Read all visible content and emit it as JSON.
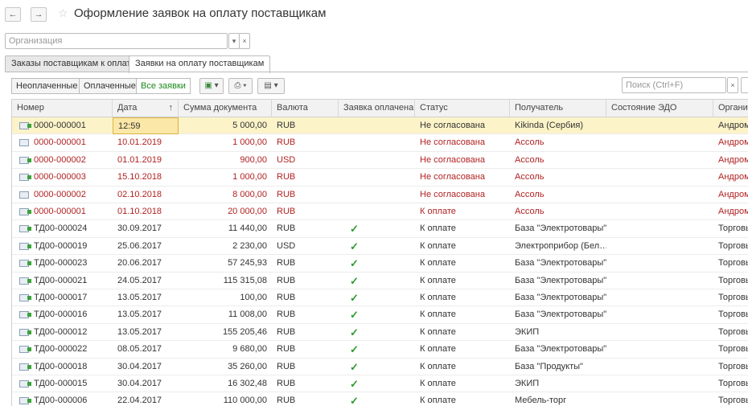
{
  "window": {
    "title": "Оформление заявок на оплату поставщикам",
    "back_icon": "arrow-left-icon",
    "forward_icon": "arrow-right-icon",
    "favorite_icon": "star-icon"
  },
  "filter": {
    "organization_placeholder": "Организация",
    "dropdown_glyph": "▾",
    "clear_glyph": "×"
  },
  "tabs": [
    {
      "label": "Заказы поставщикам к оплате"
    },
    {
      "label": "Заявки на оплату поставщикам"
    }
  ],
  "toolbar": {
    "unpaid": "Неоплаченные",
    "paid": "Оплаченные",
    "all": "Все заявки",
    "search_placeholder": "Поиск (Ctrl+F)",
    "search_clear": "×"
  },
  "table": {
    "columns": [
      "Номер",
      "Дата",
      "Сумма документа",
      "Валюта",
      "Заявка оплачена",
      "Статус",
      "Получатель",
      "Состояние ЭДО",
      "Организ"
    ],
    "sort_indicator": "↑",
    "rows": [
      {
        "num": "0000-000001",
        "date": "12:59",
        "sum": "5 000,00",
        "cur": "RUB",
        "paid": "",
        "status": "Не согласована",
        "recipient": "Kikinda (Сербия)",
        "edo": "",
        "org": "Андром",
        "style": "selected",
        "icon": "posted"
      },
      {
        "num": "0000-000001",
        "date": "10.01.2019",
        "sum": "1 000,00",
        "cur": "RUB",
        "paid": "",
        "status": "Не согласована",
        "recipient": "Ассоль",
        "edo": "",
        "org": "Андром",
        "style": "red",
        "icon": "plain"
      },
      {
        "num": "0000-000002",
        "date": "01.01.2019",
        "sum": "900,00",
        "cur": "USD",
        "paid": "",
        "status": "Не согласована",
        "recipient": "Ассоль",
        "edo": "",
        "org": "Андром",
        "style": "red",
        "icon": "posted"
      },
      {
        "num": "0000-000003",
        "date": "15.10.2018",
        "sum": "1 000,00",
        "cur": "RUB",
        "paid": "",
        "status": "Не согласована",
        "recipient": "Ассоль",
        "edo": "",
        "org": "Андром",
        "style": "red",
        "icon": "posted"
      },
      {
        "num": "0000-000002",
        "date": "02.10.2018",
        "sum": "8 000,00",
        "cur": "RUB",
        "paid": "",
        "status": "Не согласована",
        "recipient": "Ассоль",
        "edo": "",
        "org": "Андром",
        "style": "red",
        "icon": "plain"
      },
      {
        "num": "0000-000001",
        "date": "01.10.2018",
        "sum": "20 000,00",
        "cur": "RUB",
        "paid": "",
        "status": "К оплате",
        "recipient": "Ассоль",
        "edo": "",
        "org": "Андром",
        "style": "red",
        "icon": "posted"
      },
      {
        "num": "ТД00-000024",
        "date": "30.09.2017",
        "sum": "11 440,00",
        "cur": "RUB",
        "paid": "✓",
        "status": "К оплате",
        "recipient": "База \"Электротовары\"",
        "edo": "",
        "org": "Торговь",
        "style": "normal",
        "icon": "posted"
      },
      {
        "num": "ТД00-000019",
        "date": "25.06.2017",
        "sum": "2 230,00",
        "cur": "USD",
        "paid": "✓",
        "status": "К оплате",
        "recipient": "Электроприбор (Бел…",
        "edo": "",
        "org": "Торговь",
        "style": "normal",
        "icon": "posted"
      },
      {
        "num": "ТД00-000023",
        "date": "20.06.2017",
        "sum": "57 245,93",
        "cur": "RUB",
        "paid": "✓",
        "status": "К оплате",
        "recipient": "База \"Электротовары\"",
        "edo": "",
        "org": "Торговь",
        "style": "normal",
        "icon": "posted"
      },
      {
        "num": "ТД00-000021",
        "date": "24.05.2017",
        "sum": "115 315,08",
        "cur": "RUB",
        "paid": "✓",
        "status": "К оплате",
        "recipient": "База \"Электротовары\"",
        "edo": "",
        "org": "Торговь",
        "style": "normal",
        "icon": "posted"
      },
      {
        "num": "ТД00-000017",
        "date": "13.05.2017",
        "sum": "100,00",
        "cur": "RUB",
        "paid": "✓",
        "status": "К оплате",
        "recipient": "База \"Электротовары\"",
        "edo": "",
        "org": "Торговь",
        "style": "normal",
        "icon": "posted"
      },
      {
        "num": "ТД00-000016",
        "date": "13.05.2017",
        "sum": "11 008,00",
        "cur": "RUB",
        "paid": "✓",
        "status": "К оплате",
        "recipient": "База \"Электротовары\"",
        "edo": "",
        "org": "Торговь",
        "style": "normal",
        "icon": "posted"
      },
      {
        "num": "ТД00-000012",
        "date": "13.05.2017",
        "sum": "155 205,46",
        "cur": "RUB",
        "paid": "✓",
        "status": "К оплате",
        "recipient": "ЭКИП",
        "edo": "",
        "org": "Торговь",
        "style": "normal",
        "icon": "posted"
      },
      {
        "num": "ТД00-000022",
        "date": "08.05.2017",
        "sum": "9 680,00",
        "cur": "RUB",
        "paid": "✓",
        "status": "К оплате",
        "recipient": "База \"Электротовары\"",
        "edo": "",
        "org": "Торговь",
        "style": "normal",
        "icon": "posted"
      },
      {
        "num": "ТД00-000018",
        "date": "30.04.2017",
        "sum": "35 260,00",
        "cur": "RUB",
        "paid": "✓",
        "status": "К оплате",
        "recipient": "База \"Продукты\"",
        "edo": "",
        "org": "Торговь",
        "style": "normal",
        "icon": "posted"
      },
      {
        "num": "ТД00-000015",
        "date": "30.04.2017",
        "sum": "16 302,48",
        "cur": "RUB",
        "paid": "✓",
        "status": "К оплате",
        "recipient": "ЭКИП",
        "edo": "",
        "org": "Торговь",
        "style": "normal",
        "icon": "posted"
      },
      {
        "num": "ТД00-000006",
        "date": "22.04.2017",
        "sum": "110 000,00",
        "cur": "RUB",
        "paid": "✓",
        "status": "К оплате",
        "recipient": "Мебель-торг",
        "edo": "",
        "org": "Торговь",
        "style": "normal",
        "icon": "posted"
      }
    ]
  },
  "colors": {
    "accent_green": "#1b8a1b",
    "unapproved_red": "#b22222",
    "selected_row": "#fcf3c8"
  }
}
